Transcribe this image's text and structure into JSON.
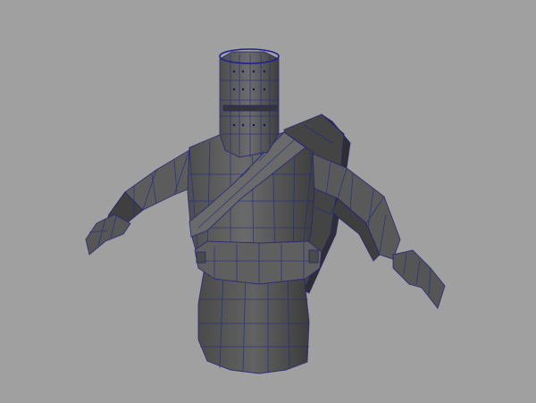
{
  "viewport": {
    "background": "#a0a0a0",
    "display_mode": "wireframe-on-shaded",
    "selection_highlight": "#20208c"
  },
  "model": {
    "type": "low-poly knight mesh",
    "parts": [
      "bucket-helmet",
      "torso",
      "left-arm",
      "right-arm",
      "belt",
      "shoulder-strap",
      "shield",
      "tunic-skirt"
    ],
    "wire_color": "#1c2a8a",
    "base_color": "#5a5a5a"
  }
}
